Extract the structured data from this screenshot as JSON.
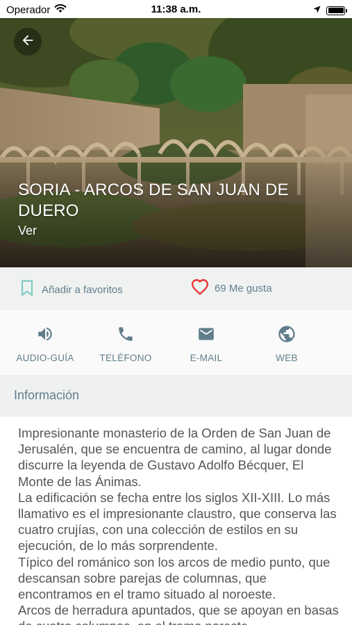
{
  "status_bar": {
    "carrier": "Operador",
    "time": "11:38 a.m.",
    "battery_level": 1.0
  },
  "hero": {
    "title": "SORIA - ARCOS DE SAN JUAN DE DUERO",
    "subtitle": "Ver",
    "back_icon": "arrow-left-icon"
  },
  "actions": {
    "favorite_label": "Añadir a favoritos",
    "favorite_icon": "bookmark-icon",
    "like_label": "69 Me gusta",
    "like_icon": "heart-icon"
  },
  "contacts": [
    {
      "label": "AUDIO-GUÍA",
      "icon": "speaker-icon"
    },
    {
      "label": "TELÉFONO",
      "icon": "phone-icon"
    },
    {
      "label": "E-MAIL",
      "icon": "envelope-icon"
    },
    {
      "label": "WEB",
      "icon": "globe-icon"
    }
  ],
  "section": {
    "title": "Información"
  },
  "description": {
    "paragraphs": [
      "Impresionante monasterio de la Orden de San Juan de Jerusalén, que se encuentra de camino, al lugar donde discurre la leyenda de Gustavo Adolfo Bécquer, El Monte de las Ánimas.",
      "La edificación se fecha entre los siglos XII-XIII. Lo más llamativo es el impresionante claustro, que conserva las cuatro crujías, con una colección de estilos en su ejecución, de lo más sorprendente.",
      "Típico del románico son los arcos de medio punto, que descansan sobre parejas de columnas, que encontramos en el tramo situado al noroeste.",
      "Arcos de herradura apuntados, que se apoyan en basas de cuatro columnas, en el tramo noreste."
    ]
  },
  "colors": {
    "accent": "#607d8b",
    "bookmark": "#80cbc4",
    "heart": "#e53935",
    "bar_bg": "#f0f2f2"
  }
}
